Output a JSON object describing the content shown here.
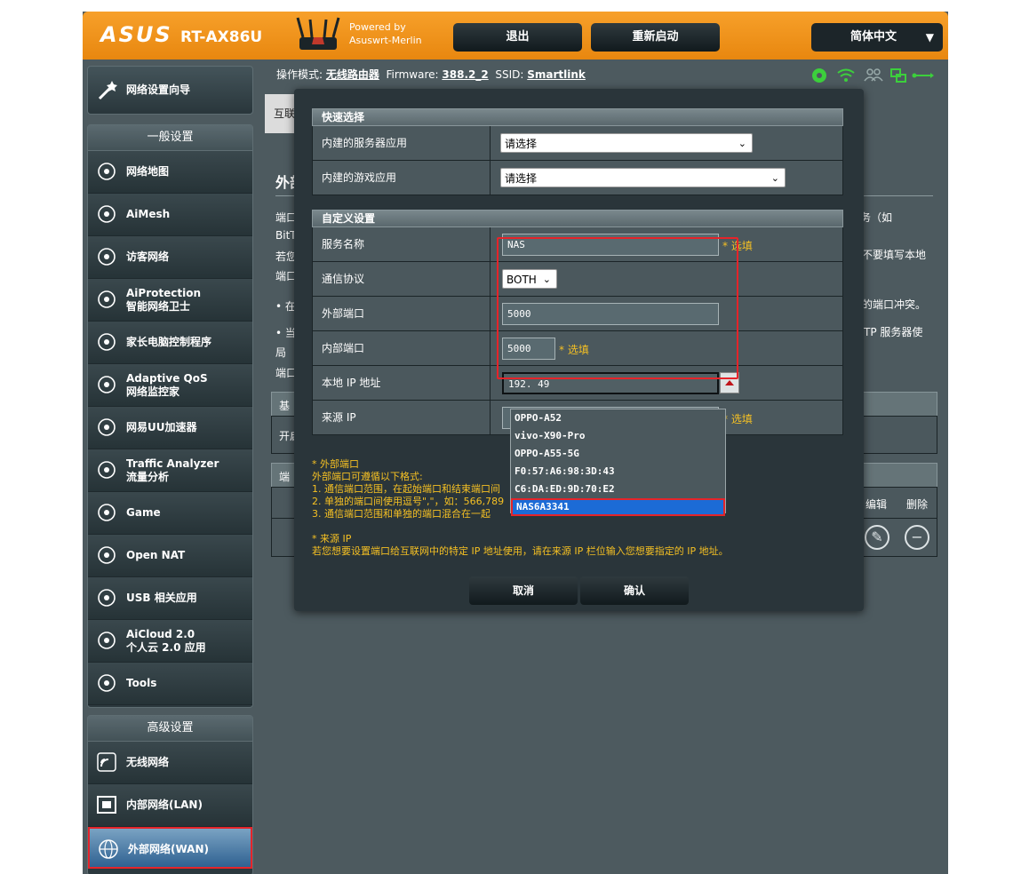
{
  "header": {
    "brand": "ASUS",
    "model": "RT-AX86U",
    "powered_line1": "Powered by",
    "powered_line2": "Asuswrt-Merlin",
    "logout": "退出",
    "reboot": "重新启动",
    "language": "简体中文"
  },
  "status": {
    "mode_label": "操作模式:",
    "mode_value": "无线路由器",
    "fw_label": "Firmware:",
    "fw_value": "388.2_2",
    "ssid_label": "SSID:",
    "ssid_value": "Smartlink"
  },
  "sidebar": {
    "wizard": "网络设置向导",
    "general_title": "一般设置",
    "general": [
      {
        "label": "网络地图",
        "sub": ""
      },
      {
        "label": "AiMesh",
        "sub": ""
      },
      {
        "label": "访客网络",
        "sub": ""
      },
      {
        "label": "AiProtection",
        "sub": "智能网络卫士"
      },
      {
        "label": "家长电脑控制程序",
        "sub": ""
      },
      {
        "label": "Adaptive QoS",
        "sub": "网络监控家"
      },
      {
        "label": "网易UU加速器",
        "sub": ""
      },
      {
        "label": "Traffic Analyzer",
        "sub": "流量分析"
      },
      {
        "label": "Game",
        "sub": ""
      },
      {
        "label": "Open NAT",
        "sub": ""
      },
      {
        "label": "USB 相关应用",
        "sub": ""
      },
      {
        "label": "AiCloud 2.0",
        "sub": "个人云 2.0 应用"
      },
      {
        "label": "Tools",
        "sub": ""
      }
    ],
    "advanced_title": "高级设置",
    "advanced": [
      {
        "label": "无线网络"
      },
      {
        "label": "内部网络(LAN)"
      },
      {
        "label": "外部网络(WAN)"
      }
    ]
  },
  "background": {
    "tab": "互联",
    "title": "外部",
    "lines": [
      "端口",
      "BitT",
      "若您",
      "端口"
    ],
    "bullets": [
      "• 在",
      "• 当",
      "  局"
    ],
    "footer": "端口",
    "right1": "务（如",
    "right2": "不要填写本地",
    "right3": "的端口冲突。",
    "right4": "TP 服务器使",
    "bar1_label": "基",
    "bar2_label": "开启",
    "bar3_label": "端",
    "edit_col": "编辑",
    "delete_col": "删除"
  },
  "modal": {
    "quick_title": "快速选择",
    "server_app_label": "内建的服务器应用",
    "server_app_value": "请选择",
    "game_app_label": "内建的游戏应用",
    "game_app_value": "请选择",
    "custom_title": "自定义设置",
    "service_name_label": "服务名称",
    "service_name_value": "NAS",
    "optional": "* 选填",
    "protocol_label": "通信协议",
    "protocol_value": "BOTH",
    "ext_port_label": "外部端口",
    "ext_port_value": "5000",
    "int_port_label": "内部端口",
    "int_port_value": "5000",
    "local_ip_label": "本地 IP 地址",
    "local_ip_value": "192.          49",
    "source_ip_label": "来源 IP",
    "dropdown_items": [
      "OPPO-A52",
      "vivo-X90-Pro",
      "OPPO-A55-5G",
      "F0:57:A6:98:3D:43",
      "C6:DA:ED:9D:70:E2",
      "NAS6A3341"
    ],
    "notes": [
      "* 外部端口",
      "外部端口可遵循以下格式:",
      "1. 通信端口范围，在起始端口和结束端口间",
      "2. 单独的端口间使用逗号\",\"，如：566,789",
      "3. 通信端口范围和单独的端口混合在一起",
      "",
      "* 来源 IP",
      "若您想要设置端口给互联网中的特定 IP 地址使用，请在来源 IP 栏位输入您想要指定的 IP 地址。"
    ],
    "cancel": "取消",
    "confirm": "确认"
  }
}
